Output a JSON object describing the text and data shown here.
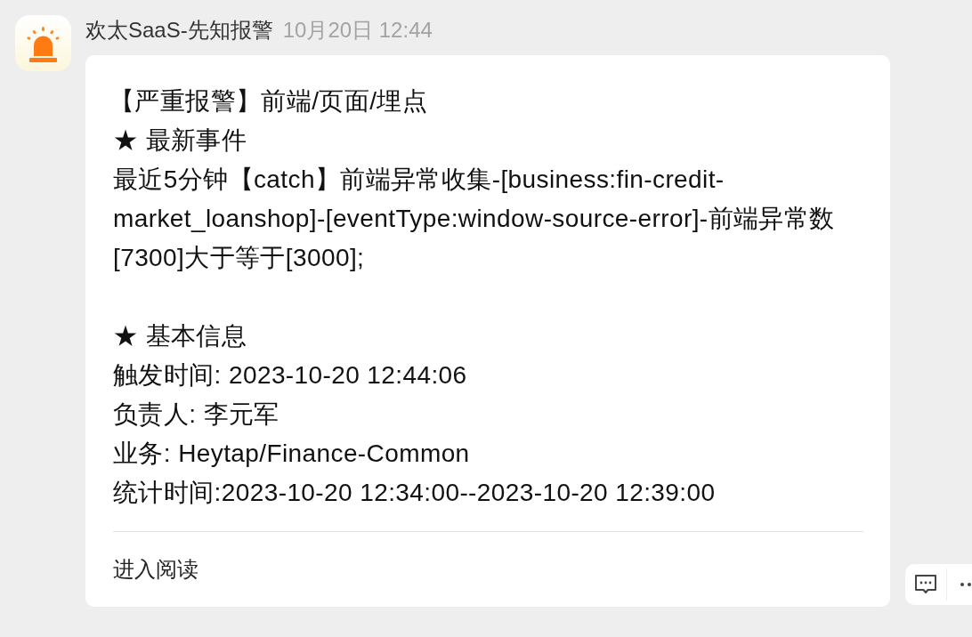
{
  "sender": {
    "name": "欢太SaaS-先知报警",
    "time": "10月20日 12:44"
  },
  "message": {
    "title": "【严重报警】前端/页面/埋点",
    "sections": [
      {
        "heading": "★ 最新事件",
        "lines": [
          "最近5分钟【catch】前端异常收集-[business:fin-credit-",
          "market_loanshop]-[eventType:window-source-error]-前端异常数",
          "[7300]大于等于[3000];"
        ]
      },
      {
        "heading": "★ 基本信息",
        "lines": [
          "触发时间: 2023-10-20 12:44:06",
          "负责人: 李元军",
          "业务: Heytap/Finance-Common",
          "统计时间:2023-10-20 12:34:00--2023-10-20 12:39:00"
        ]
      }
    ],
    "footer_link": "进入阅读"
  }
}
